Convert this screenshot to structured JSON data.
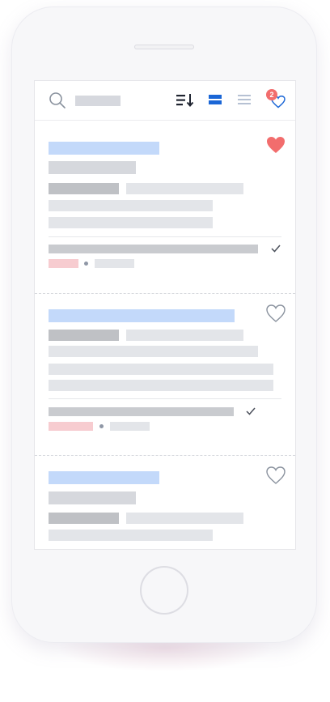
{
  "toolbar": {
    "favorites_count": "2"
  },
  "colors": {
    "accent_blue": "#1a66d6",
    "favorite_red": "#f26d6d",
    "placeholder_blue": "#c3d9fa",
    "placeholder_grey": "#d6d8dd",
    "placeholder_pink": "#f7ccd0"
  },
  "icons": {
    "search": "search-icon",
    "sort": "sort-icon",
    "grid_view": "grid-view-icon",
    "list_view": "list-view-icon",
    "favorites": "heart-icon",
    "verified": "check-icon"
  },
  "cards": [
    {
      "favorited": true,
      "verified": true
    },
    {
      "favorited": false,
      "verified": true
    },
    {
      "favorited": false,
      "verified": false
    }
  ]
}
